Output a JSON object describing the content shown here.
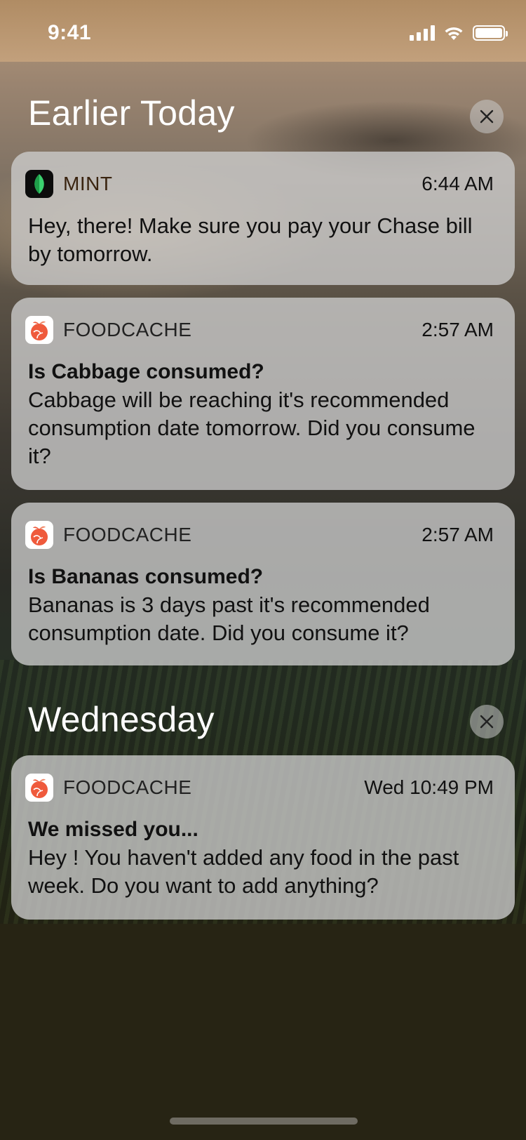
{
  "status_bar": {
    "time": "9:41",
    "icons": [
      "cellular-signal-icon",
      "wifi-icon",
      "battery-icon"
    ]
  },
  "sections": [
    {
      "title": "Earlier Today",
      "notifications": [
        {
          "app": "MINT",
          "icon": "mint-leaf-icon",
          "time": "6:44 AM",
          "title": "",
          "body": "Hey, there! Make sure you pay your Chase bill by tomorrow."
        },
        {
          "app": "FOODCACHE",
          "icon": "foodcache-fruit-icon",
          "time": "2:57 AM",
          "title": "Is Cabbage consumed?",
          "body": "Cabbage will be reaching it's recommended consumption date tomorrow. Did you consume it?"
        },
        {
          "app": "FOODCACHE",
          "icon": "foodcache-fruit-icon",
          "time": "2:57 AM",
          "title": "Is Bananas consumed?",
          "body": "Bananas is 3 days past it's recommended consumption date. Did you consume it?"
        }
      ]
    },
    {
      "title": "Wednesday",
      "notifications": [
        {
          "app": "FOODCACHE",
          "icon": "foodcache-fruit-icon",
          "time": "Wed 10:49 PM",
          "title": "We missed you...",
          "body": "Hey ! You haven't added any food in the past week. Do you want to add anything?"
        }
      ]
    }
  ],
  "colors": {
    "mint_green": "#3bd16f",
    "foodcache_orange": "#ef5a3c",
    "card_bg": "#cdcdcd"
  }
}
